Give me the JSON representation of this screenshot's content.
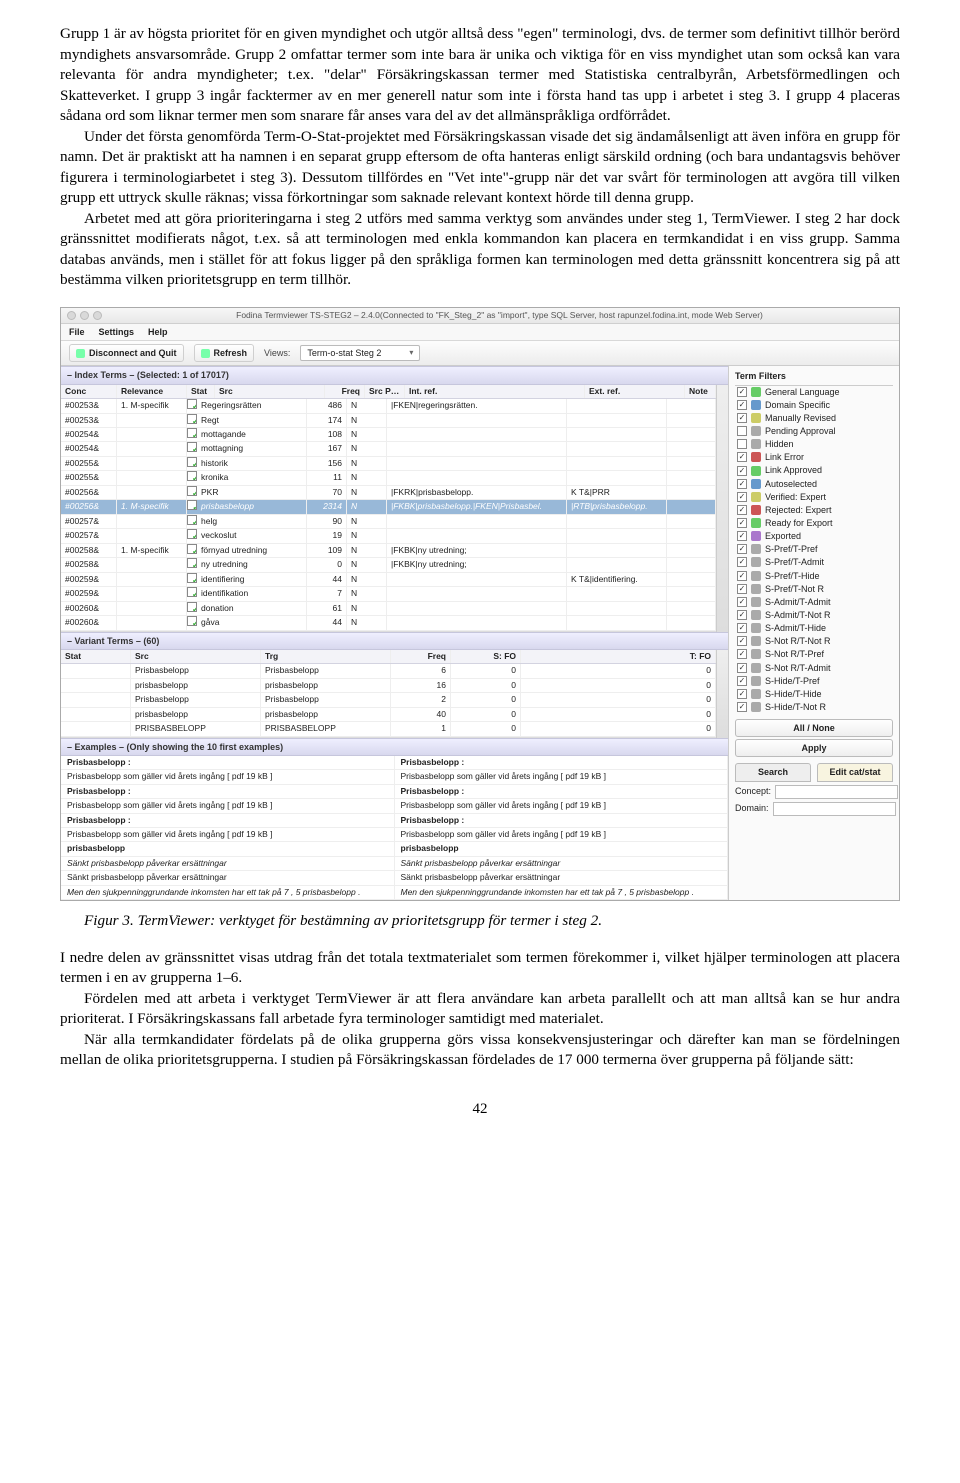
{
  "paragraphs": {
    "p1a": "Grupp 1 är av högsta prioritet för en given myndighet och utgör alltså dess \"egen\" terminologi, dvs. de termer som definitivt tillhör berörd myndighets ansvarsområde. Grupp 2 omfattar termer som inte bara är unika och viktiga för en viss myndighet utan som också kan vara relevanta för andra myndigheter; t.ex. \"delar\" Försäkringskassan termer med Statistiska centralbyrån, Arbetsförmedlingen och Skatteverket. I grupp 3 ingår facktermer av en mer generell natur som inte i första hand tas upp i arbetet i steg 3. I grupp 4 placeras sådana ord som liknar termer men som snarare får anses vara del av det allmänspråkliga ordförrådet.",
    "p2": "Under det första genomförda Term-O-Stat-projektet med Försäkringskassan visade det sig ändamålsenligt att även införa en grupp för namn. Det är praktiskt att ha namnen i en separat grupp eftersom de ofta hanteras enligt särskild ordning (och bara undantagsvis behöver figurera i terminologiarbetet i steg 3). Dessutom tillfördes en \"Vet inte\"-grupp när det var svårt för terminologen att avgöra till vilken grupp ett uttryck skulle räknas; vissa förkortningar som saknade relevant kontext hörde till denna grupp.",
    "p3": "Arbetet med att göra prioriteringarna i steg 2 utförs med samma verktyg som användes under steg 1, TermViewer. I steg 2 har dock gränssnittet modifierats något, t.ex. så att terminologen med enkla kommandon kan placera en termkandidat i en viss grupp. Samma databas används, men i stället för att fokus ligger på den språkliga formen kan terminologen med detta gränssnitt koncentrera sig på att bestämma vilken prioritetsgrupp en term tillhör.",
    "caption": "Figur 3. TermViewer: verktyget för bestämning av prioritetsgrupp för termer i steg 2.",
    "p4": "I nedre delen av gränssnittet visas utdrag från det totala textmaterialet som termen förekommer i, vilket hjälper terminologen att placera termen i en av grupperna 1–6.",
    "p5": "Fördelen med att arbeta i verktyget TermViewer är att flera användare kan arbeta parallellt och att man alltså kan se hur andra prioriterat. I Försäkringskassans fall arbetade fyra terminologer samtidigt med materialet.",
    "p6": "När alla termkandidater fördelats på de olika grupperna görs vissa konsekvensjusteringar och därefter kan man se fördelningen mellan de olika prioritetsgrupperna. I studien på Försäkringskassan fördelades de 17 000 termerna över grupperna på följande sätt:"
  },
  "page_number": "42",
  "app": {
    "window_title": "Fodina Termviewer TS-STEG2 – 2.4.0(Connected to \"FK_Steg_2\" as \"import\", type SQL Server, host rapunzel.fodina.int, mode Web Server)",
    "menu": {
      "file": "File",
      "settings": "Settings",
      "help": "Help"
    },
    "toolbar": {
      "disconnect": "Disconnect and Quit",
      "refresh": "Refresh",
      "views_label": "Views:",
      "view_value": "Term-o-stat Steg 2"
    },
    "panels": {
      "index_header": "– Index Terms –  (Selected: 1 of 17017)",
      "variant_header": "– Variant Terms –  (60)",
      "examples_header": "– Examples – (Only showing the 10 first examples)",
      "filters_header": "Term Filters"
    },
    "index_cols": {
      "conc": "Conc",
      "rel": "Relevance",
      "stat": "Stat",
      "src": "Src",
      "freq": "Freq",
      "spos": "Src Pos",
      "int": "Int. ref.",
      "ext": "Ext. ref.",
      "note": "Note"
    },
    "index_rows": [
      {
        "conc": "#00253&",
        "rel": "1. M-specifik",
        "stat": "chk",
        "src": "Regeringsrätten",
        "freq": "486",
        "spos": "N",
        "int": "|FKEN|regeringsrätten.",
        "ext": "",
        "note": ""
      },
      {
        "conc": "#00253&",
        "rel": "",
        "stat": "chk",
        "src": "Regt",
        "freq": "174",
        "spos": "N",
        "int": "",
        "ext": "",
        "note": ""
      },
      {
        "conc": "#00254&",
        "rel": "",
        "stat": "chk",
        "src": "mottagande",
        "freq": "108",
        "spos": "N",
        "int": "",
        "ext": "",
        "note": ""
      },
      {
        "conc": "#00254&",
        "rel": "",
        "stat": "chk",
        "src": "mottagning",
        "freq": "167",
        "spos": "N",
        "int": "",
        "ext": "",
        "note": ""
      },
      {
        "conc": "#00255&",
        "rel": "",
        "stat": "chk",
        "src": "historik",
        "freq": "156",
        "spos": "N",
        "int": "",
        "ext": "",
        "note": ""
      },
      {
        "conc": "#00255&",
        "rel": "",
        "stat": "chk",
        "src": "kronika",
        "freq": "11",
        "spos": "N",
        "int": "",
        "ext": "",
        "note": ""
      },
      {
        "conc": "#00256&",
        "rel": "",
        "stat": "chk",
        "src": "PKR",
        "freq": "70",
        "spos": "N",
        "int": "|FKRK|prisbasbelopp.",
        "ext": "K T&|PRR",
        "note": ""
      },
      {
        "conc": "#00256&",
        "rel": "1. M-specifik",
        "stat": "chk",
        "src": "prisbasbelopp",
        "freq": "2314",
        "spos": "N",
        "int": "|FKBK|prisbasbelopp.|FKEN|Prisbasbel.",
        "ext": "|RTB|prisbasbelopp.",
        "note": ""
      },
      {
        "conc": "#00257&",
        "rel": "",
        "stat": "chk",
        "src": "helg",
        "freq": "90",
        "spos": "N",
        "int": "",
        "ext": "",
        "note": ""
      },
      {
        "conc": "#00257&",
        "rel": "",
        "stat": "chk",
        "src": "veckoslut",
        "freq": "19",
        "spos": "N",
        "int": "",
        "ext": "",
        "note": ""
      },
      {
        "conc": "#00258&",
        "rel": "1. M-specifik",
        "stat": "chk",
        "src": "förnyad utredning",
        "freq": "109",
        "spos": "N",
        "int": "|FKBK|ny utredning;",
        "ext": "",
        "note": ""
      },
      {
        "conc": "#00258&",
        "rel": "",
        "stat": "chk",
        "src": "ny utredning",
        "freq": "0",
        "spos": "N",
        "int": "|FKBK|ny utredning;",
        "ext": "",
        "note": ""
      },
      {
        "conc": "#00259&",
        "rel": "",
        "stat": "chk",
        "src": "identifiering",
        "freq": "44",
        "spos": "N",
        "int": "",
        "ext": "K T&|identifiering.",
        "note": ""
      },
      {
        "conc": "#00259&",
        "rel": "",
        "stat": "chk",
        "src": "identifikation",
        "freq": "7",
        "spos": "N",
        "int": "",
        "ext": "",
        "note": ""
      },
      {
        "conc": "#00260&",
        "rel": "",
        "stat": "chk",
        "src": "donation",
        "freq": "61",
        "spos": "N",
        "int": "",
        "ext": "",
        "note": ""
      },
      {
        "conc": "#00260&",
        "rel": "",
        "stat": "chk",
        "src": "gåva",
        "freq": "44",
        "spos": "N",
        "int": "",
        "ext": "",
        "note": ""
      }
    ],
    "variant_cols": {
      "stat": "Stat",
      "src": "Src",
      "trg": "Trg",
      "freq": "Freq",
      "sfo": "S: FO",
      "tfo": "T: FO"
    },
    "variant_rows": [
      {
        "stat": "",
        "src": "Prisbasbelopp",
        "trg": "Prisbasbelopp",
        "freq": "6",
        "sfo": "0",
        "tfo": "0"
      },
      {
        "stat": "",
        "src": "prisbasbelopp",
        "trg": "prisbasbelopp",
        "freq": "16",
        "sfo": "0",
        "tfo": "0"
      },
      {
        "stat": "",
        "src": "Prisbasbelopp",
        "trg": "Prisbasbelopp",
        "freq": "2",
        "sfo": "0",
        "tfo": "0"
      },
      {
        "stat": "",
        "src": "prisbasbelopp",
        "trg": "prisbasbelopp",
        "freq": "40",
        "sfo": "0",
        "tfo": "0"
      },
      {
        "stat": "",
        "src": "PRISBASBELOPP",
        "trg": "PRISBASBELOPP",
        "freq": "1",
        "sfo": "0",
        "tfo": "0"
      }
    ],
    "examples": [
      {
        "l": "Prisbasbelopp :",
        "r": "Prisbasbelopp :",
        "bold": true
      },
      {
        "l": "Prisbasbelopp som gäller vid årets ingång [ pdf 19 kB ]",
        "r": "Prisbasbelopp som gäller vid årets ingång [ pdf 19 kB ]"
      },
      {
        "l": "Prisbasbelopp :",
        "r": "Prisbasbelopp :",
        "bold": true
      },
      {
        "l": "Prisbasbelopp som gäller vid årets ingång [ pdf 19 kB ]",
        "r": "Prisbasbelopp som gäller vid årets ingång [ pdf 19 kB ]"
      },
      {
        "l": "Prisbasbelopp :",
        "r": "Prisbasbelopp :",
        "bold": true
      },
      {
        "l": "Prisbasbelopp som gäller vid årets ingång [ pdf 19 kB ]",
        "r": "Prisbasbelopp som gäller vid årets ingång [ pdf 19 kB ]"
      },
      {
        "l": "prisbasbelopp",
        "r": "prisbasbelopp",
        "bold": true
      },
      {
        "l": "Sänkt prisbasbelopp påverkar ersättningar",
        "r": "Sänkt prisbasbelopp påverkar ersättningar",
        "it": true
      },
      {
        "l": "Sänkt prisbasbelopp påverkar ersättningar",
        "r": "Sänkt prisbasbelopp påverkar ersättningar"
      },
      {
        "l": "Men den sjukpenninggrundande inkomsten har ett tak på 7 , 5 prisbasbelopp .",
        "r": "Men den sjukpenninggrundande inkomsten har ett tak på 7 , 5 prisbasbelopp .",
        "it": true
      }
    ],
    "filters": [
      {
        "on": true,
        "ico": "mi-g",
        "label": "General Language"
      },
      {
        "on": true,
        "ico": "mi-b",
        "label": "Domain Specific"
      },
      {
        "on": true,
        "ico": "mi-y",
        "label": "Manually Revised"
      },
      {
        "on": false,
        "ico": "mi-gr",
        "label": "Pending Approval"
      },
      {
        "on": false,
        "ico": "mi-gr",
        "label": "Hidden"
      },
      {
        "on": true,
        "ico": "mi-x",
        "label": "Link Error"
      },
      {
        "on": true,
        "ico": "mi-g",
        "label": "Link Approved"
      },
      {
        "on": true,
        "ico": "mi-b",
        "label": "Autoselected"
      },
      {
        "on": true,
        "ico": "mi-y",
        "label": "Verified: Expert"
      },
      {
        "on": true,
        "ico": "mi-x",
        "label": "Rejected: Expert"
      },
      {
        "on": true,
        "ico": "mi-g",
        "label": "Ready for Export"
      },
      {
        "on": true,
        "ico": "mi-p",
        "label": "Exported"
      },
      {
        "on": true,
        "ico": "mi-gr",
        "label": "S-Pref/T-Pref"
      },
      {
        "on": true,
        "ico": "mi-gr",
        "label": "S-Pref/T-Admit"
      },
      {
        "on": true,
        "ico": "mi-gr",
        "label": "S-Pref/T-Hide"
      },
      {
        "on": true,
        "ico": "mi-gr",
        "label": "S-Pref/T-Not R"
      },
      {
        "on": true,
        "ico": "mi-gr",
        "label": "S-Admit/T-Admit"
      },
      {
        "on": true,
        "ico": "mi-gr",
        "label": "S-Admit/T-Not R"
      },
      {
        "on": true,
        "ico": "mi-gr",
        "label": "S-Admit/T-Hide"
      },
      {
        "on": true,
        "ico": "mi-gr",
        "label": "S-Not R/T-Not R"
      },
      {
        "on": true,
        "ico": "mi-gr",
        "label": "S-Not R/T-Pref"
      },
      {
        "on": true,
        "ico": "mi-gr",
        "label": "S-Not R/T-Admit"
      },
      {
        "on": true,
        "ico": "mi-gr",
        "label": "S-Hide/T-Pref"
      },
      {
        "on": true,
        "ico": "mi-gr",
        "label": "S-Hide/T-Hide"
      },
      {
        "on": true,
        "ico": "mi-gr",
        "label": "S-Hide/T-Not R"
      }
    ],
    "buttons": {
      "allnone": "All / None",
      "apply": "Apply"
    },
    "search": {
      "tab_search": "Search",
      "tab_edit": "Edit cat/stat",
      "concept": "Concept:",
      "domain": "Domain:"
    }
  }
}
